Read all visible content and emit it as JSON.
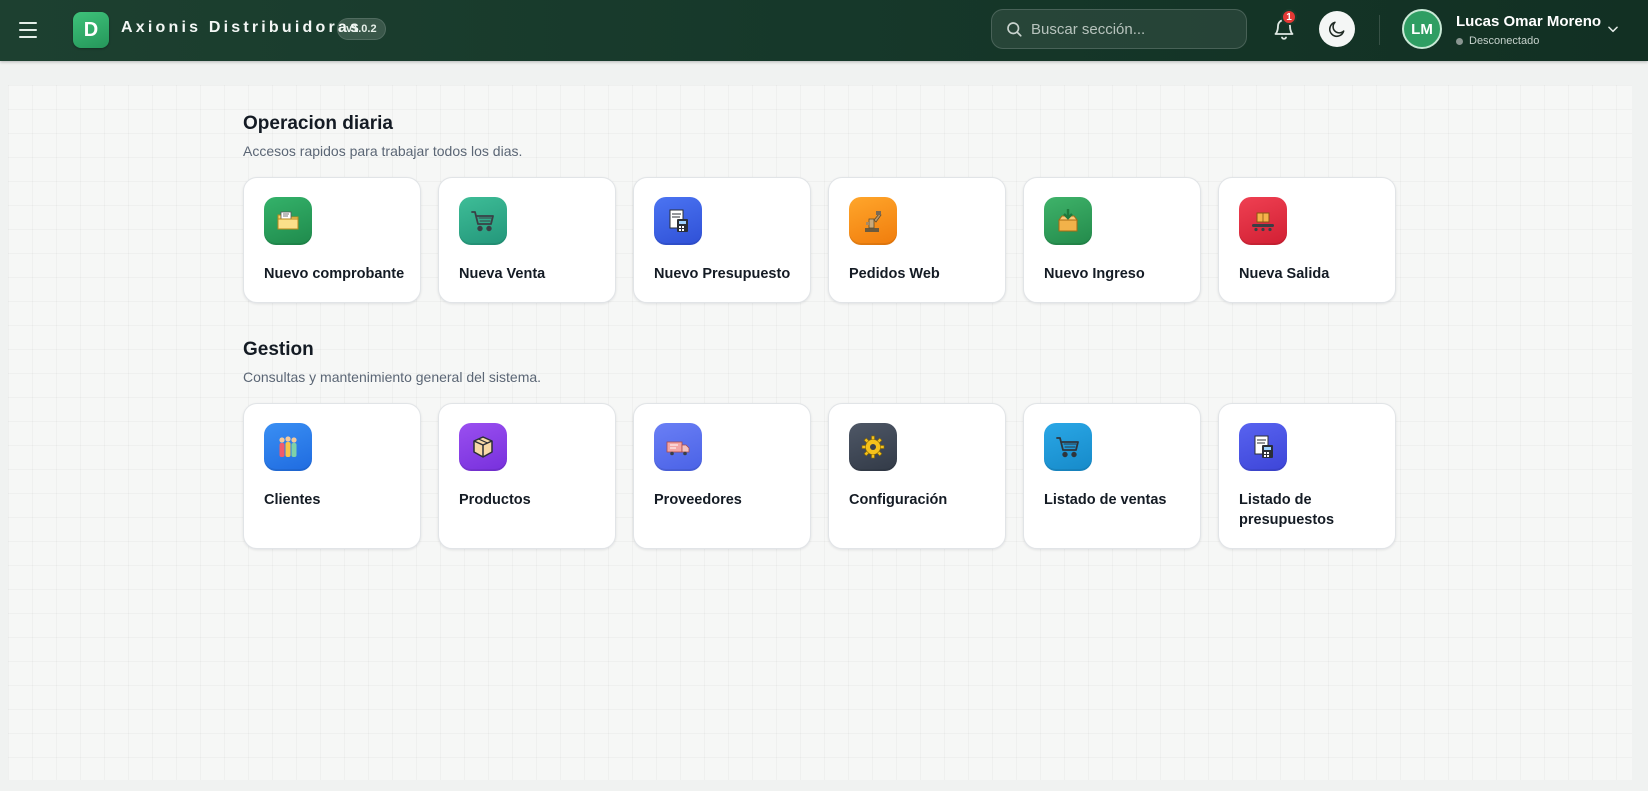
{
  "header": {
    "logo_letter": "D",
    "brand": "Axionis Distribuidoras",
    "version": "v1.0.2",
    "search_placeholder": "Buscar sección...",
    "notification_count": "1",
    "user": {
      "initials": "LM",
      "name": "Lucas Omar Moreno",
      "status": "Desconectado"
    }
  },
  "sections": {
    "daily": {
      "title": "Operacion diaria",
      "subtitle": "Accesos rapidos para trabajar todos los dias.",
      "cards": [
        {
          "label": "Nuevo comprobante",
          "icon": "folder-icon",
          "color": "#2aa05c"
        },
        {
          "label": "Nueva Venta",
          "icon": "cart-icon",
          "color": "#31ac88"
        },
        {
          "label": "Nuevo Presupuesto",
          "icon": "calculator-icon",
          "color": "#3d62e6"
        },
        {
          "label": "Pedidos Web",
          "icon": "robot-arm-icon",
          "color": "#f89120"
        },
        {
          "label": "Nuevo Ingreso",
          "icon": "box-in-icon",
          "color": "#2f9f5b"
        },
        {
          "label": "Nueva Salida",
          "icon": "conveyor-icon",
          "color": "#e03042"
        }
      ]
    },
    "management": {
      "title": "Gestion",
      "subtitle": "Consultas y mantenimiento general del sistema.",
      "cards": [
        {
          "label": "Clientes",
          "icon": "people-icon",
          "color": "#2c7eea"
        },
        {
          "label": "Productos",
          "icon": "package-icon",
          "color": "#8840e6"
        },
        {
          "label": "Proveedores",
          "icon": "truck-icon",
          "color": "#5a70ee"
        },
        {
          "label": "Configuración",
          "icon": "gear-icon",
          "color": "#3f4855"
        },
        {
          "label": "Listado de ventas",
          "icon": "cart-icon",
          "color": "#2098d8"
        },
        {
          "label": "Listado de presupuestos",
          "icon": "calculator-icon",
          "color": "#4a54e4"
        }
      ]
    }
  }
}
